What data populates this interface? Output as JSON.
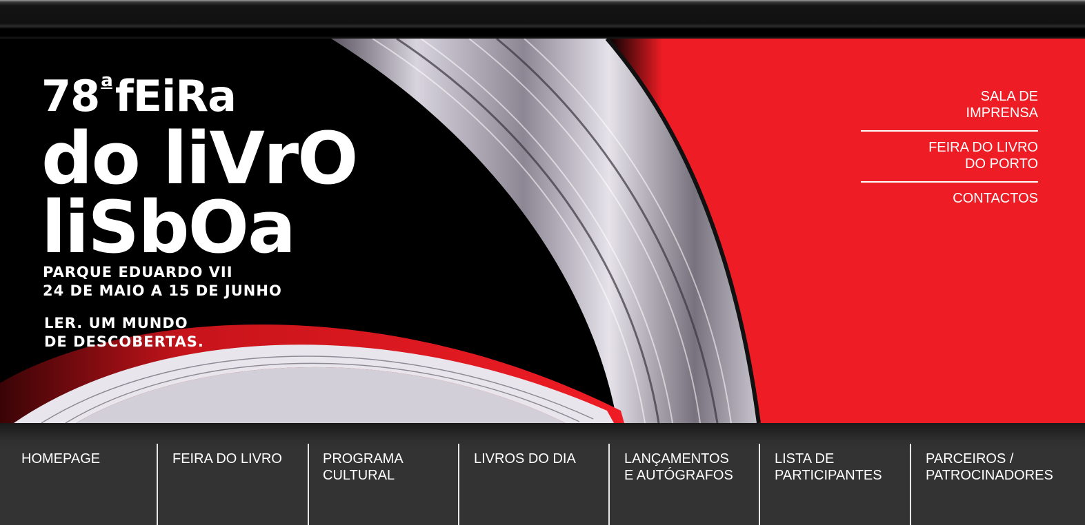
{
  "poster": {
    "edition_number": "78",
    "edition_ordinal": "a",
    "edition_word": "fEiRa",
    "title_line1": "do liVrO",
    "title_line2": "liSbOa",
    "venue": "PARQUE EDUARDO VII",
    "dates": "24 DE MAIO A 15 DE JUNHO",
    "tagline_line1": "LER. UM MUNDO",
    "tagline_line2": "DE DESCOBERTAS."
  },
  "side_nav": [
    {
      "line1": "SALA DE",
      "line2": "IMPRENSA"
    },
    {
      "line1": "FEIRA DO LIVRO",
      "line2": "DO PORTO"
    },
    {
      "line1": "CONTACTOS",
      "line2": ""
    }
  ],
  "main_nav": [
    {
      "line1": "HOMEPAGE",
      "line2": ""
    },
    {
      "line1": "FEIRA DO LIVRO",
      "line2": ""
    },
    {
      "line1": "PROGRAMA",
      "line2": "CULTURAL"
    },
    {
      "line1": "LIVROS DO DIA",
      "line2": ""
    },
    {
      "line1": "LANÇAMENTOS",
      "line2": "E AUTÓGRAFOS"
    },
    {
      "line1": "LISTA DE",
      "line2": "PARTICIPANTES"
    },
    {
      "line1": "PARCEIROS /",
      "line2": "PATROCINADORES"
    }
  ],
  "colors": {
    "brand_red": "#ee1c24",
    "poster_black": "#000000",
    "nav_background": "#333333",
    "text": "#ffffff"
  }
}
